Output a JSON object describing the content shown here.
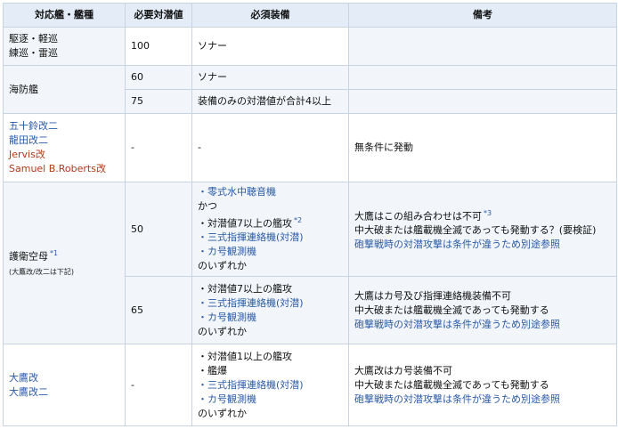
{
  "header": {
    "col1": "対応艦・艦種",
    "col2": "必要対潜値",
    "col3": "必須装備",
    "col4": "備考"
  },
  "rows": {
    "r1": {
      "ship1": "駆逐・軽巡",
      "ship2": "練巡・雷巡",
      "value": "100",
      "equip": "ソナー",
      "note": ""
    },
    "r2": {
      "ship": "海防艦",
      "value_a": "60",
      "equip_a": "ソナー",
      "value_b": "75",
      "equip_b": "装備のみの対潜値が合計4以上"
    },
    "r3": {
      "ship1": "五十鈴改二",
      "ship2": "龍田改二",
      "ship3": "Jervis改",
      "ship4": "Samuel B.Roberts改",
      "value": "-",
      "equip": "-",
      "note": "無条件に発動"
    },
    "r4": {
      "ship": "護衛空母",
      "ship_sup": "*1",
      "ship_note": "(大鷹改/改二は下記)",
      "value_a": "50",
      "equip_a": {
        "l1": "・零式水中聴音機",
        "l2": "かつ",
        "l3": "・対潜値7以上の艦攻",
        "l3_sup": "*2",
        "l4": "・三式指揮連絡機(対潜)",
        "l5": "・カ号観測機",
        "l6": "のいずれか"
      },
      "note_a": {
        "l1": "大鷹はこの組み合わせは不可",
        "l1_sup": "*3",
        "l2": "中大破または艦載機全滅であっても発動する？(要検証)",
        "l3": "砲撃戦時の対潜攻撃は条件が違うため別途参照"
      },
      "value_b": "65",
      "equip_b": {
        "l1": "・対潜値7以上の艦攻",
        "l2": "・三式指揮連絡機(対潜)",
        "l3": "・カ号観測機",
        "l4": "のいずれか"
      },
      "note_b": {
        "l1": "大鷹はカ号及び指揮連絡機装備不可",
        "l2": "中大破または艦載機全滅であっても発動する",
        "l3": "砲撃戦時の対潜攻撃は条件が違うため別途参照"
      }
    },
    "r5": {
      "ship1": "大鷹改",
      "ship2": "大鷹改二",
      "value": "-",
      "equip": {
        "l1": "・対潜値1以上の艦攻",
        "l2": "・艦爆",
        "l3": "・三式指揮連絡機(対潜)",
        "l4": "・カ号観測機",
        "l5": "のいずれか"
      },
      "note": {
        "l1": "大鷹改はカ号装備不可",
        "l2": "中大破または艦載機全滅であっても発動する",
        "l3": "砲撃戦時の対潜攻撃は条件が違うため別途参照"
      }
    }
  },
  "colors": {
    "header_bg": "#e4edf7",
    "row_bg": "#f2f6fb",
    "link": "#2a5aa6",
    "accent_red": "#b03a18",
    "border": "#c8d4e2"
  }
}
